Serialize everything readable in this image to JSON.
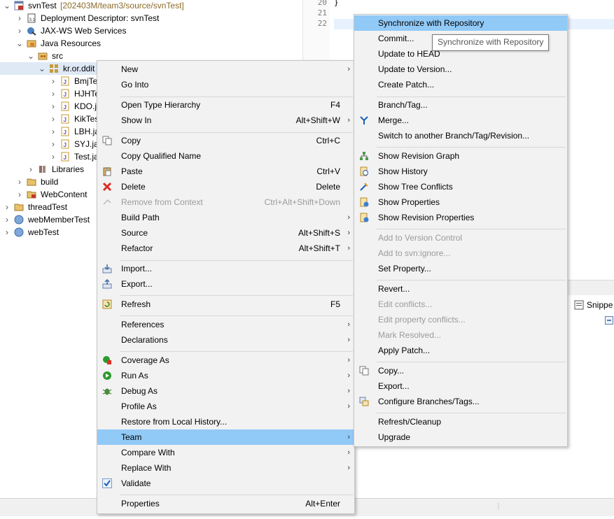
{
  "tree": {
    "project": {
      "name": "svnTest",
      "decoration": "[202403M/team3/source/svnTest]"
    },
    "deployment_descriptor": "Deployment Descriptor: svnTest",
    "jaxws": "JAX-WS Web Services",
    "java_resources": "Java Resources",
    "src": "src",
    "package": "kr.or.ddit",
    "files": [
      "BmjTe",
      "HJHTe",
      "KDO.j",
      "KikTes",
      "LBH.ja",
      "SYJ.jav",
      "Test.ja"
    ],
    "libraries": "Libraries",
    "build": "build",
    "webcontent": "WebContent",
    "other_projects": [
      "threadTest",
      "webMemberTest",
      "webTest"
    ]
  },
  "editor": {
    "line_numbers": [
      "20",
      "21",
      "22"
    ],
    "line_20_code": "}"
  },
  "snippets_tab": "Snippe",
  "tooltip": "Synchronize with Repository",
  "context_menu": {
    "items": [
      {
        "label": "New",
        "shortcut": "",
        "submenu": true,
        "disabled": false,
        "icon": ""
      },
      {
        "label": "Go Into",
        "shortcut": "",
        "submenu": false,
        "disabled": false,
        "icon": ""
      },
      {
        "label": "Open Type Hierarchy",
        "shortcut": "F4",
        "submenu": false,
        "disabled": false,
        "icon": ""
      },
      {
        "label": "Show In",
        "shortcut": "Alt+Shift+W",
        "submenu": true,
        "disabled": false,
        "icon": ""
      },
      {
        "label": "Copy",
        "shortcut": "Ctrl+C",
        "submenu": false,
        "disabled": false,
        "icon": "copy-icon"
      },
      {
        "label": "Copy Qualified Name",
        "shortcut": "",
        "submenu": false,
        "disabled": false,
        "icon": "copy-qualified-icon"
      },
      {
        "label": "Paste",
        "shortcut": "Ctrl+V",
        "submenu": false,
        "disabled": false,
        "icon": "paste-icon"
      },
      {
        "label": "Delete",
        "shortcut": "Delete",
        "submenu": false,
        "disabled": false,
        "icon": "delete-icon"
      },
      {
        "label": "Remove from Context",
        "shortcut": "Ctrl+Alt+Shift+Down",
        "submenu": false,
        "disabled": true,
        "icon": "remove-context-icon"
      },
      {
        "label": "Build Path",
        "shortcut": "",
        "submenu": true,
        "disabled": false,
        "icon": ""
      },
      {
        "label": "Source",
        "shortcut": "Alt+Shift+S",
        "submenu": true,
        "disabled": false,
        "icon": ""
      },
      {
        "label": "Refactor",
        "shortcut": "Alt+Shift+T",
        "submenu": true,
        "disabled": false,
        "icon": ""
      },
      {
        "label": "Import...",
        "shortcut": "",
        "submenu": false,
        "disabled": false,
        "icon": "import-icon"
      },
      {
        "label": "Export...",
        "shortcut": "",
        "submenu": false,
        "disabled": false,
        "icon": "export-icon"
      },
      {
        "label": "Refresh",
        "shortcut": "F5",
        "submenu": false,
        "disabled": false,
        "icon": "refresh-icon"
      },
      {
        "label": "References",
        "shortcut": "",
        "submenu": true,
        "disabled": false,
        "icon": ""
      },
      {
        "label": "Declarations",
        "shortcut": "",
        "submenu": true,
        "disabled": false,
        "icon": ""
      },
      {
        "label": "Coverage As",
        "shortcut": "",
        "submenu": true,
        "disabled": false,
        "icon": "coverage-icon"
      },
      {
        "label": "Run As",
        "shortcut": "",
        "submenu": true,
        "disabled": false,
        "icon": "run-icon"
      },
      {
        "label": "Debug As",
        "shortcut": "",
        "submenu": true,
        "disabled": false,
        "icon": "debug-icon"
      },
      {
        "label": "Profile As",
        "shortcut": "",
        "submenu": true,
        "disabled": false,
        "icon": ""
      },
      {
        "label": "Restore from Local History...",
        "shortcut": "",
        "submenu": false,
        "disabled": false,
        "icon": ""
      },
      {
        "label": "Team",
        "shortcut": "",
        "submenu": true,
        "disabled": false,
        "icon": "",
        "selected": true
      },
      {
        "label": "Compare With",
        "shortcut": "",
        "submenu": true,
        "disabled": false,
        "icon": ""
      },
      {
        "label": "Replace With",
        "shortcut": "",
        "submenu": true,
        "disabled": false,
        "icon": ""
      },
      {
        "label": "Validate",
        "shortcut": "",
        "submenu": false,
        "disabled": false,
        "icon": "validate-check-icon"
      },
      {
        "label": "Properties",
        "shortcut": "Alt+Enter",
        "submenu": false,
        "disabled": false,
        "icon": ""
      }
    ]
  },
  "team_menu": {
    "items": [
      {
        "label": "Synchronize with Repository",
        "disabled": false,
        "icon": "",
        "selected": true
      },
      {
        "label": "Commit...",
        "disabled": false,
        "icon": ""
      },
      {
        "label": "Update to HEAD",
        "disabled": false,
        "icon": ""
      },
      {
        "label": "Update to Version...",
        "disabled": false,
        "icon": ""
      },
      {
        "label": "Create Patch...",
        "disabled": false,
        "icon": ""
      },
      {
        "label": "Branch/Tag...",
        "disabled": false,
        "icon": ""
      },
      {
        "label": "Merge...",
        "disabled": false,
        "icon": "merge-icon"
      },
      {
        "label": "Switch to another Branch/Tag/Revision...",
        "disabled": false,
        "icon": ""
      },
      {
        "label": "Show Revision Graph",
        "disabled": false,
        "icon": "revision-graph-icon"
      },
      {
        "label": "Show History",
        "disabled": false,
        "icon": "history-icon"
      },
      {
        "label": "Show Tree Conflicts",
        "disabled": false,
        "icon": "tree-conflicts-icon"
      },
      {
        "label": "Show Properties",
        "disabled": false,
        "icon": "properties-icon"
      },
      {
        "label": "Show Revision Properties",
        "disabled": false,
        "icon": "revision-properties-icon"
      },
      {
        "label": "Add to Version Control",
        "disabled": true,
        "icon": ""
      },
      {
        "label": "Add to svn:ignore...",
        "disabled": true,
        "icon": ""
      },
      {
        "label": "Set Property...",
        "disabled": false,
        "icon": ""
      },
      {
        "label": "Revert...",
        "disabled": false,
        "icon": ""
      },
      {
        "label": "Edit conflicts...",
        "disabled": true,
        "icon": ""
      },
      {
        "label": "Edit property conflicts...",
        "disabled": true,
        "icon": ""
      },
      {
        "label": "Mark Resolved...",
        "disabled": true,
        "icon": ""
      },
      {
        "label": "Apply Patch...",
        "disabled": false,
        "icon": ""
      },
      {
        "label": "Copy...",
        "disabled": false,
        "icon": "svn-copy-icon"
      },
      {
        "label": "Export...",
        "disabled": false,
        "icon": ""
      },
      {
        "label": "Configure Branches/Tags...",
        "disabled": false,
        "icon": "configure-branches-icon"
      },
      {
        "label": "Refresh/Cleanup",
        "disabled": false,
        "icon": ""
      },
      {
        "label": "Upgrade",
        "disabled": false,
        "icon": ""
      }
    ]
  },
  "colors": {
    "menu_bg": "#f2f2f2",
    "selection": "#91c9f7",
    "disabled_text": "#9b9b9b",
    "tree_decoration": "#8b6b28"
  }
}
